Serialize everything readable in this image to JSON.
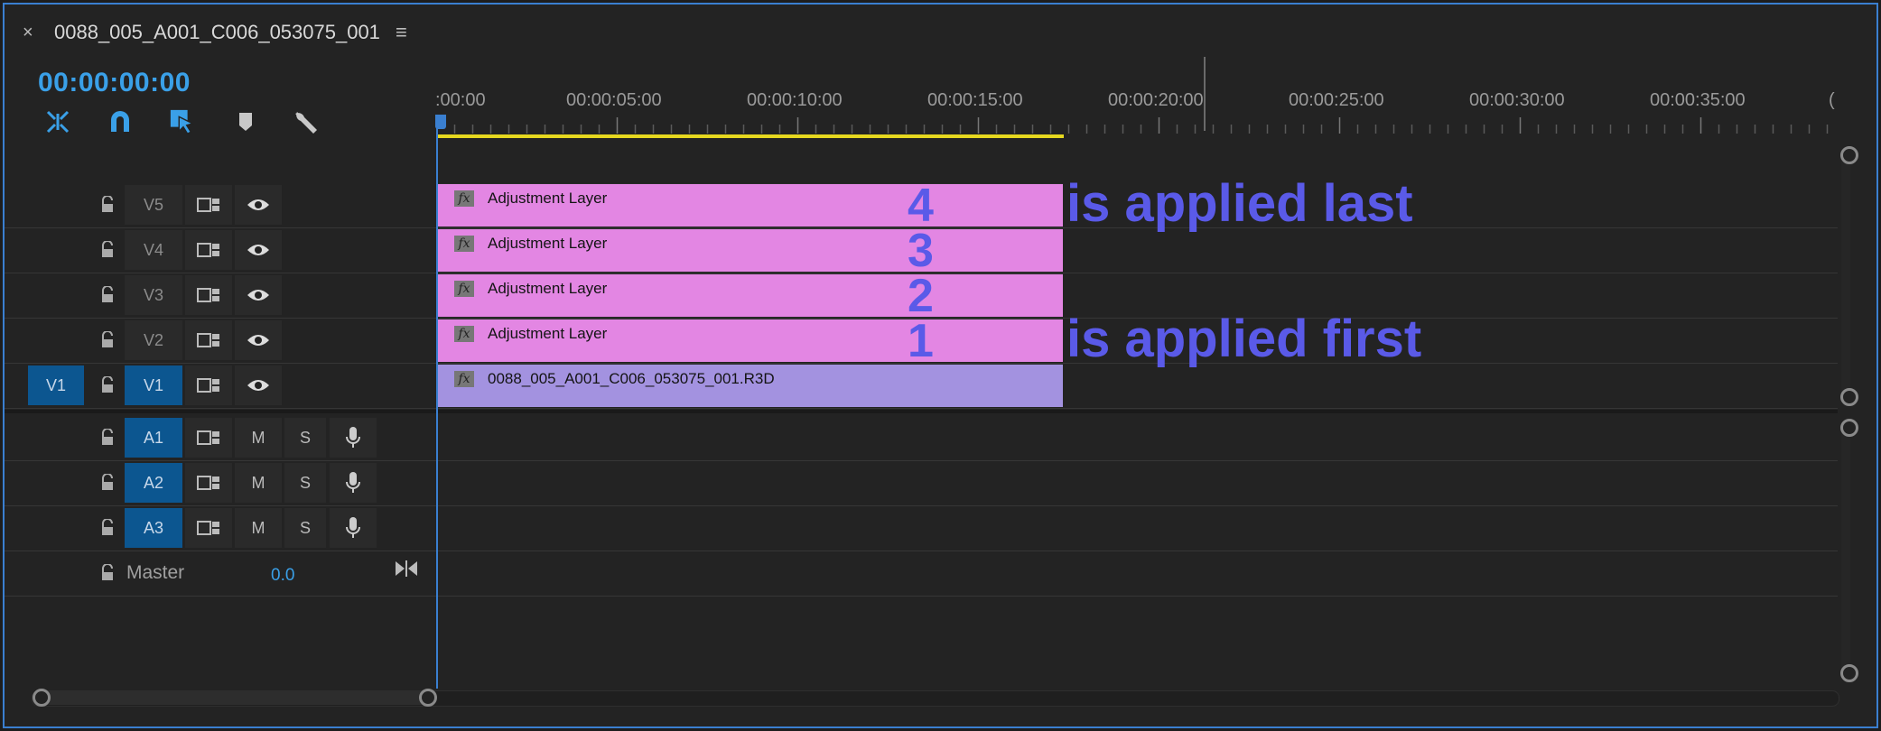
{
  "window": {
    "close_glyph": "×",
    "sequence_name": "0088_005_A001_C006_053075_001",
    "menu_glyph": "≡"
  },
  "timecode": "00:00:00:00",
  "toolbar": [
    "snap-in-icon",
    "magnet-icon",
    "linked-selection-icon",
    "add-marker-icon",
    "wrench-icon"
  ],
  "ruler": {
    "labels": [
      ":00:00",
      "00:00:05:00",
      "00:00:10:00",
      "00:00:15:00",
      "00:00:20:00",
      "00:00:25:00",
      "00:00:30:00",
      "00:00:35:00",
      "("
    ]
  },
  "video_tracks": [
    {
      "source": "",
      "name": "V5",
      "clip": "Adjustment Layer",
      "order": "4",
      "annotation": "is applied last"
    },
    {
      "source": "",
      "name": "V4",
      "clip": "Adjustment Layer",
      "order": "3",
      "annotation": ""
    },
    {
      "source": "",
      "name": "V3",
      "clip": "Adjustment Layer",
      "order": "2",
      "annotation": ""
    },
    {
      "source": "",
      "name": "V2",
      "clip": "Adjustment Layer",
      "order": "1",
      "annotation": "is applied first"
    },
    {
      "source": "V1",
      "name": "V1",
      "clip": "0088_005_A001_C006_053075_001.R3D",
      "order": "",
      "annotation": ""
    }
  ],
  "audio_tracks": [
    {
      "name": "A1",
      "mute": "M",
      "solo": "S"
    },
    {
      "name": "A2",
      "mute": "M",
      "solo": "S"
    },
    {
      "name": "A3",
      "mute": "M",
      "solo": "S"
    }
  ],
  "master": {
    "label": "Master",
    "value": "0.0"
  },
  "fx_label": "fx",
  "colors": {
    "accent": "#3aa0e8",
    "adjustment_clip": "#e386e3",
    "video_clip": "#a392e0",
    "annotation": "#5a5ae8",
    "work_area": "#e6d81f",
    "track_target": "#0c5690"
  }
}
